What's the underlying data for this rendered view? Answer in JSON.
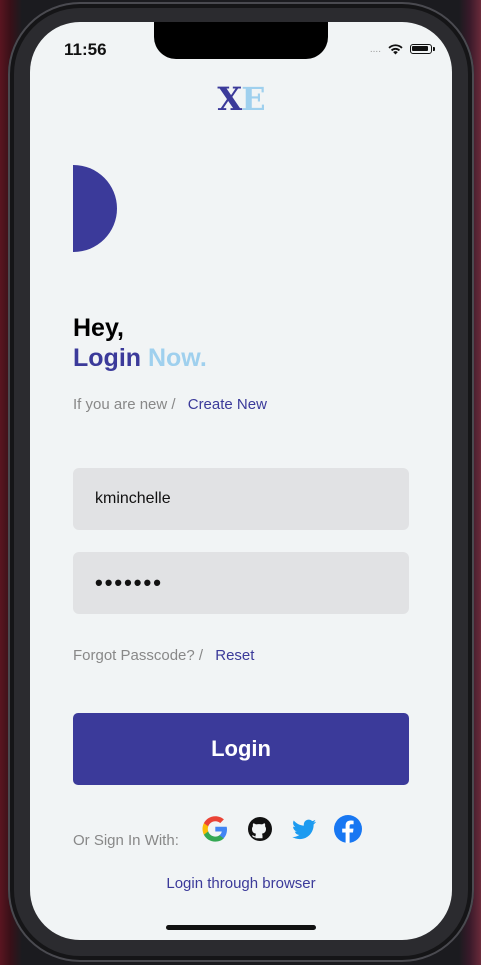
{
  "status_bar": {
    "time": "11:56",
    "signal": "....",
    "icons": [
      "wifi-icon",
      "battery-icon"
    ]
  },
  "logo": {
    "x": "X",
    "e": "E"
  },
  "colors": {
    "primary": "#3b3a9a",
    "accent": "#9fd0ee",
    "muted": "#888888",
    "field_bg": "#e1e2e4"
  },
  "heading": {
    "hey": "Hey,",
    "login": "Login",
    "now": "Now."
  },
  "signup": {
    "prompt": "If you are new /",
    "link": "Create New"
  },
  "form": {
    "username_value": "kminchelle",
    "password_value": "•••••••"
  },
  "forgot": {
    "prompt": "Forgot Passcode? /",
    "link": "Reset"
  },
  "login_button": "Login",
  "social": {
    "label": "Or Sign In With:",
    "providers": [
      "google-icon",
      "github-icon",
      "twitter-icon",
      "facebook-icon"
    ]
  },
  "browser_link": "Login through browser"
}
